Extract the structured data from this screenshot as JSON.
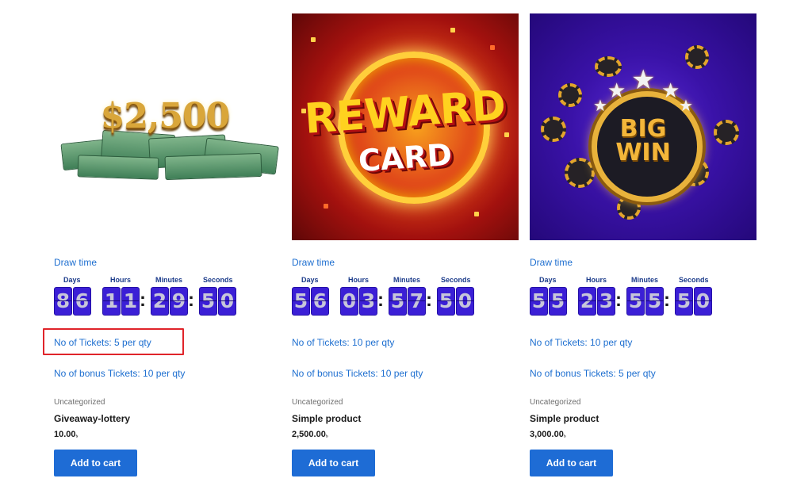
{
  "products": [
    {
      "image": "money-2500",
      "image_text": "$2,500",
      "draw_time_label": "Draw time",
      "countdown": {
        "days": "86",
        "hours": "11",
        "minutes": "29",
        "seconds": "50"
      },
      "tickets": "No of Tickets: 5 per qty",
      "bonus_tickets": "No of bonus Tickets: 10 per qty",
      "category": "Uncategorized",
      "title": "Giveaway-lottery",
      "price": "10.00",
      "button": "Add to cart",
      "highlighted": true
    },
    {
      "image": "reward-card",
      "image_text": [
        "REWARD",
        "CARD"
      ],
      "draw_time_label": "Draw time",
      "countdown": {
        "days": "56",
        "hours": "03",
        "minutes": "57",
        "seconds": "50"
      },
      "tickets": "No of Tickets: 10 per qty",
      "bonus_tickets": "No of bonus Tickets: 10 per qty",
      "category": "Uncategorized",
      "title": "Simple product",
      "price": "2,500.00",
      "button": "Add to cart",
      "highlighted": false
    },
    {
      "image": "big-win",
      "image_text": [
        "BIG",
        "WIN"
      ],
      "draw_time_label": "Draw time",
      "countdown": {
        "days": "55",
        "hours": "23",
        "minutes": "55",
        "seconds": "50"
      },
      "tickets": "No of Tickets: 10 per qty",
      "bonus_tickets": "No of bonus Tickets: 5 per qty",
      "category": "Uncategorized",
      "title": "Simple product",
      "price": "3,000.00",
      "button": "Add to cart",
      "highlighted": false
    }
  ],
  "countdown_labels": {
    "days": "Days",
    "hours": "Hours",
    "minutes": "Minutes",
    "seconds": "Seconds"
  },
  "currency_symbol": "৳",
  "colors": {
    "link": "#1e6fd0",
    "button": "#1e6cd5",
    "digit_bg": "#3b1fd6",
    "highlight": "#e0242a"
  }
}
